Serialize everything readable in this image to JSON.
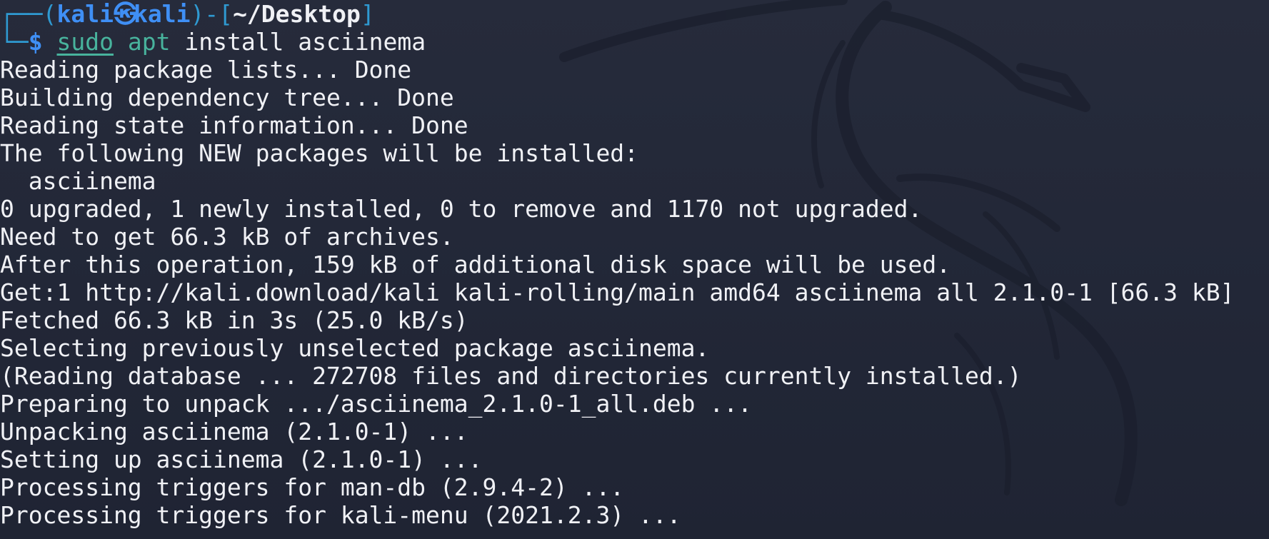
{
  "prompt": {
    "box_top": "┌──(",
    "user": "kali",
    "separator_icon": "㉿",
    "host": "kali",
    "mid": ")-[",
    "cwd": "~/Desktop",
    "close": "]",
    "box_bottom": "└─",
    "dollar": "$",
    "sudo": "sudo",
    "apt": "apt",
    "args": "install asciinema"
  },
  "output": [
    "Reading package lists... Done",
    "Building dependency tree... Done",
    "Reading state information... Done",
    "The following NEW packages will be installed:",
    "  asciinema",
    "0 upgraded, 1 newly installed, 0 to remove and 1170 not upgraded.",
    "Need to get 66.3 kB of archives.",
    "After this operation, 159 kB of additional disk space will be used.",
    "Get:1 http://kali.download/kali kali-rolling/main amd64 asciinema all 2.1.0-1 [66.3 kB]",
    "Fetched 66.3 kB in 3s (25.0 kB/s)",
    "Selecting previously unselected package asciinema.",
    "(Reading database ... 272708 files and directories currently installed.)",
    "Preparing to unpack .../asciinema_2.1.0-1_all.deb ...",
    "Unpacking asciinema (2.1.0-1) ...",
    "Setting up asciinema (2.1.0-1) ...",
    "Processing triggers for man-db (2.9.4-2) ...",
    "Processing triggers for kali-menu (2021.2.3) ..."
  ],
  "colors": {
    "background": "#23283a",
    "prompt_blue": "#3f8ff5",
    "box_blue": "#2f9ad2",
    "command_green": "#48b39d",
    "text": "#f0f1f5"
  },
  "watermark_icon": "kali-dragon-icon"
}
